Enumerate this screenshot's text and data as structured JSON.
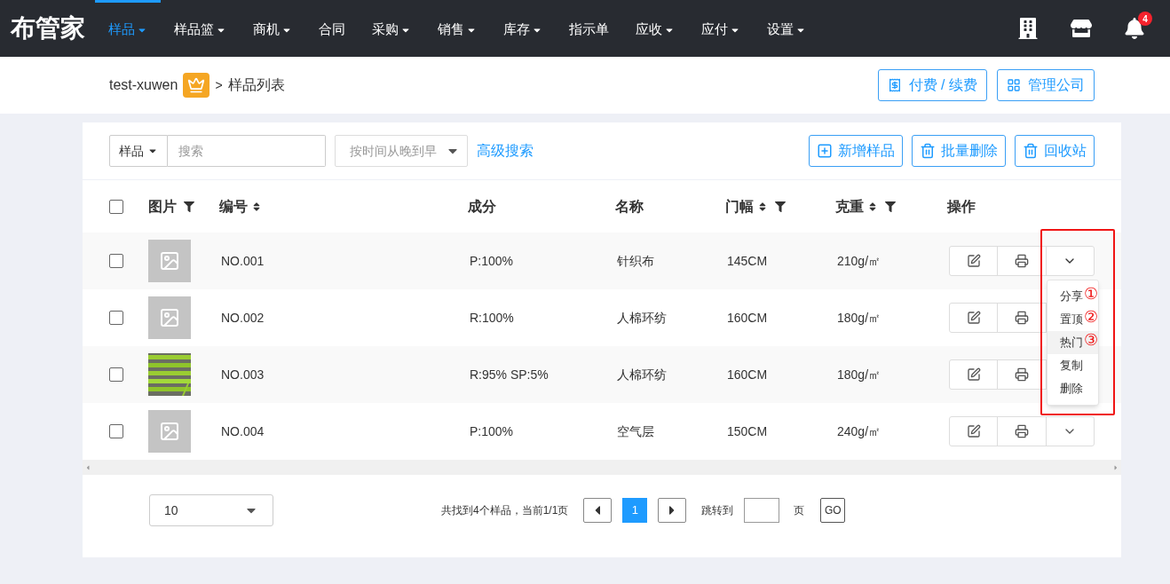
{
  "nav": {
    "logo": "布管家",
    "items": [
      {
        "label": "样品",
        "dropdown": true,
        "selected": true
      },
      {
        "label": "样品篮",
        "dropdown": true,
        "selected": false
      },
      {
        "label": "商机",
        "dropdown": true,
        "selected": false
      },
      {
        "label": "合同",
        "dropdown": false,
        "selected": false
      },
      {
        "label": "采购",
        "dropdown": true,
        "selected": false
      },
      {
        "label": "销售",
        "dropdown": true,
        "selected": false
      },
      {
        "label": "库存",
        "dropdown": true,
        "selected": false
      },
      {
        "label": "指示单",
        "dropdown": false,
        "selected": false
      },
      {
        "label": "应收",
        "dropdown": true,
        "selected": false
      },
      {
        "label": "应付",
        "dropdown": true,
        "selected": false
      },
      {
        "label": "设置",
        "dropdown": true,
        "selected": false
      }
    ],
    "notification_badge": "4"
  },
  "breadcrumb": {
    "account": "test-xuwen",
    "separator": ">",
    "page": "样品列表"
  },
  "header_buttons": [
    "付费 / 续费",
    "管理公司"
  ],
  "toolbar": {
    "scope": "样品",
    "search_placeholder": "搜索",
    "sort_placeholder": "按时间从晚到早",
    "advanced_search": "高级搜索",
    "actions": [
      "新增样品",
      "批量删除",
      "回收站"
    ]
  },
  "table": {
    "header_checked": false,
    "columns": [
      {
        "label": "图片",
        "sortable": false,
        "filterable": true
      },
      {
        "label": "编号",
        "sortable": true,
        "filterable": false
      },
      {
        "label": "成分",
        "sortable": false,
        "filterable": false
      },
      {
        "label": "名称",
        "sortable": false,
        "filterable": false
      },
      {
        "label": "门幅",
        "sortable": true,
        "filterable": true
      },
      {
        "label": "克重",
        "sortable": true,
        "filterable": true
      },
      {
        "label": "操作",
        "sortable": false,
        "filterable": false
      }
    ],
    "rows": [
      {
        "checked": false,
        "image": {
          "kind": "placeholder"
        },
        "code": "NO.001",
        "composition": "P:100%",
        "name": "针织布",
        "width": "145CM",
        "weight": "210g/㎡",
        "menu_open": true
      },
      {
        "checked": false,
        "image": {
          "kind": "placeholder"
        },
        "code": "NO.002",
        "composition": "R:100%",
        "name": "人棉环纺",
        "width": "160CM",
        "weight": "180g/㎡",
        "menu_open": false
      },
      {
        "checked": false,
        "code": "NO.003",
        "composition": "R:95% SP:5%",
        "name": "人棉环纺",
        "width": "160CM",
        "weight": "180g/㎡",
        "menu_open": false
      },
      {
        "checked": false,
        "image": {
          "kind": "placeholder"
        },
        "code": "NO.004",
        "composition": "P:100%",
        "name": "空气层",
        "width": "150CM",
        "weight": "240g/㎡",
        "menu_open": false
      }
    ]
  },
  "row_menu": {
    "items": [
      {
        "label": "分享",
        "annotation": "①",
        "highlighted": false
      },
      {
        "label": "置顶",
        "annotation": "②",
        "highlighted": false
      },
      {
        "label": "热门",
        "annotation": "③",
        "highlighted": true
      },
      {
        "label": "复制",
        "highlighted": false
      },
      {
        "label": "删除",
        "highlighted": false
      }
    ]
  },
  "pagination": {
    "page_size": "10",
    "summary": "共找到4个样品，当前1/1页",
    "pages": [
      {
        "label": "1",
        "selected": true
      }
    ],
    "jump_label": "跳转到",
    "page_unit": "页",
    "go": "GO"
  }
}
